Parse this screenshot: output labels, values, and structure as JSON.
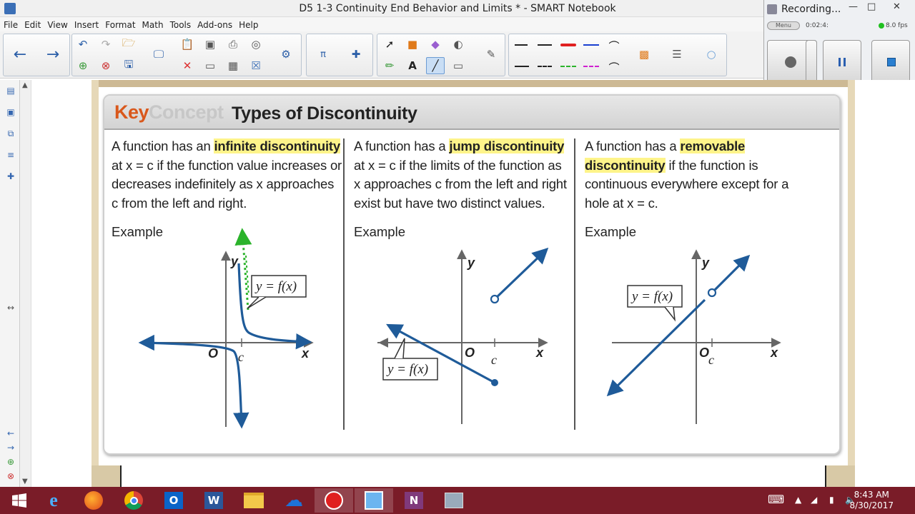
{
  "window": {
    "title": "D5 1-3 Continuity End Behavior and Limits * - SMART Notebook"
  },
  "menu": [
    "File",
    "Edit",
    "View",
    "Insert",
    "Format",
    "Math",
    "Tools",
    "Add-ons",
    "Help"
  ],
  "recorder": {
    "title": "Recording...",
    "menu_label": "Menu",
    "elapsed": "0:02:4:",
    "fps": "8.0 fps",
    "status_color": "#20c020"
  },
  "key_concept": {
    "key_word": "Key",
    "concept_word": "Concept",
    "title": "Types of Discontinuity"
  },
  "columns": [
    {
      "pre": "A function has an ",
      "term": "infinite discontinuity",
      "body": "at x = c if the function value increases or decreases indefinitely as x approaches c from the left and right.",
      "example": "Example",
      "graph_label": "y = f(x)",
      "origin": "O",
      "x_label": "x",
      "y_label": "y",
      "c_label": "c"
    },
    {
      "pre": "A function has a ",
      "term": "jump discontinuity",
      "body": "at x = c if the limits of the function as x approaches c from the left and right exist but have two distinct values.",
      "example": "Example",
      "graph_label": "y = f(x)",
      "origin": "O",
      "x_label": "x",
      "y_label": "y",
      "c_label": "c"
    },
    {
      "pre": "A function has a ",
      "term": "removable discontinuity",
      "body": "if the function is continuous everywhere except for a hole at x = c.",
      "example": "Example",
      "graph_label": "y = f(x)",
      "origin": "O",
      "x_label": "x",
      "y_label": "y",
      "c_label": "c"
    }
  ],
  "colors": {
    "highlight": "#fef48a",
    "accent_orange": "#d9581c",
    "curve_blue": "#1f5b99",
    "annotation_green": "#2bb32b",
    "taskbar": "#7a1c28"
  },
  "taskbar": {
    "time": "8:43 AM",
    "date": "8/30/2017"
  }
}
